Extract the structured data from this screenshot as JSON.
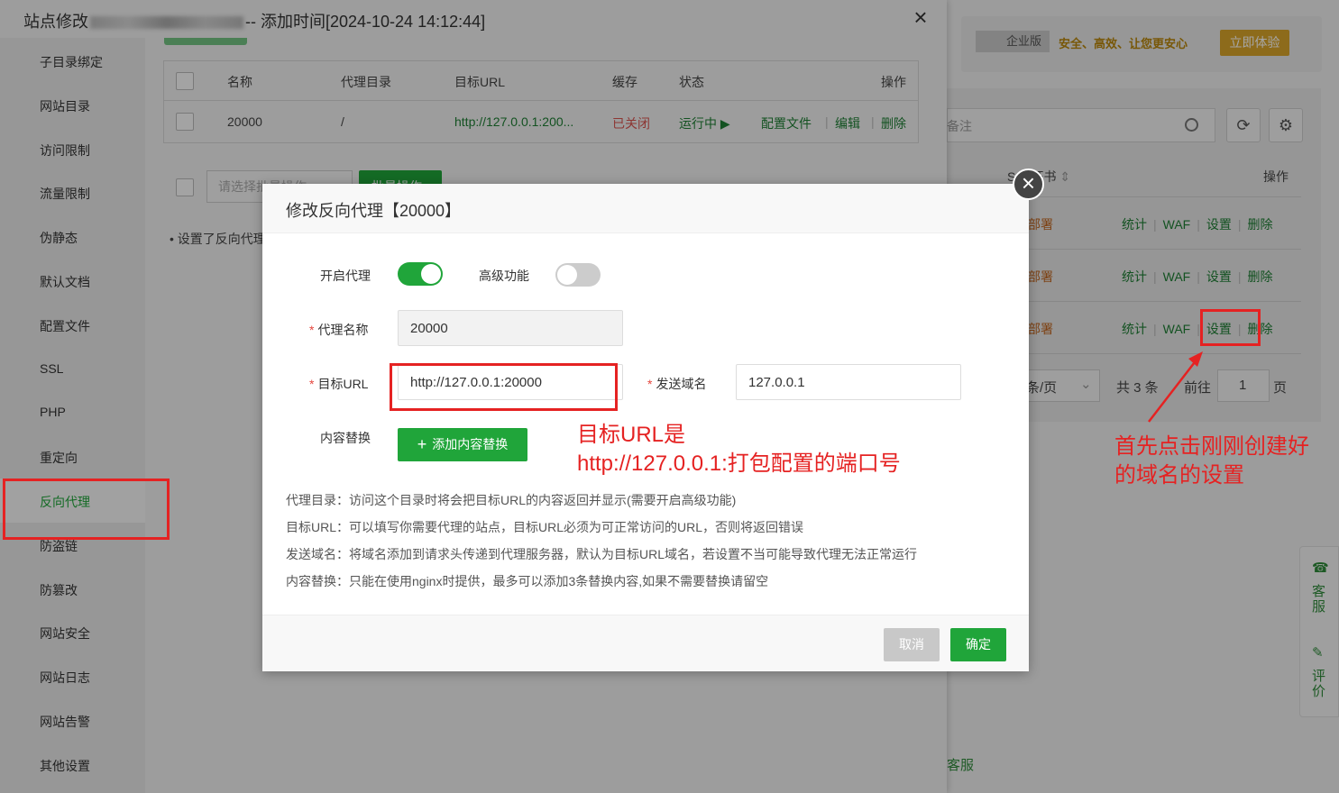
{
  "drawer": {
    "title_prefix": "站点修改",
    "title_suffix": "-- 添加时间[2024-10-24 14:12:44]",
    "close": "×"
  },
  "side_menu": {
    "items": [
      "子目录绑定",
      "网站目录",
      "访问限制",
      "流量限制",
      "伪静态",
      "默认文档",
      "配置文件",
      "SSL",
      "PHP",
      "重定向",
      "反向代理",
      "防盗链",
      "防篡改",
      "网站安全",
      "网站日志",
      "网站告警",
      "其他设置"
    ],
    "active_index": 10
  },
  "proxy_table": {
    "headers": [
      "名称",
      "代理目录",
      "目标URL",
      "缓存",
      "状态",
      "操作"
    ],
    "rows": [
      {
        "name": "20000",
        "dir": "/",
        "url": "http://127.0.0.1:200...",
        "cache": "已关闭",
        "status": "运行中 ▶",
        "ops": [
          "配置文件",
          "编辑",
          "删除"
        ]
      }
    ]
  },
  "batch": {
    "placeholder": "请选择批量操作",
    "button": "批量操作"
  },
  "note": "设置了反向代理",
  "dialog": {
    "title": "修改反向代理【20000】",
    "close": "×",
    "enable_proxy_label": "开启代理",
    "enable_proxy_on": true,
    "advanced_label": "高级功能",
    "advanced_on": false,
    "proxy_name_label": "代理名称",
    "proxy_name_value": "20000",
    "target_url_label": "目标URL",
    "target_url_value": "http://127.0.0.1:20000",
    "send_domain_label": "发送域名",
    "send_domain_value": "127.0.0.1",
    "content_replace_label": "内容替换",
    "add_replace_button": "添加内容替换",
    "help": [
      "代理目录：访问这个目录时将会把目标URL的内容返回并显示(需要开启高级功能)",
      "目标URL：可以填写你需要代理的站点，目标URL必须为可正常访问的URL，否则将返回错误",
      "发送域名：将域名添加到请求头传递到代理服务器，默认为目标URL域名，若设置不当可能导致代理无法正常运行",
      "内容替换：只能在使用nginx时提供，最多可以添加3条替换内容,如果不需要替换请留空"
    ],
    "cancel": "取消",
    "ok": "确定"
  },
  "background": {
    "badge": "企业版",
    "promo_text": "安全、高效、让您更安心",
    "promo_button": "立即体验",
    "search_placeholder": "备注",
    "ssl_header": "SSL证书",
    "ops_header": "操作",
    "rows": [
      {
        "deploy": "部署",
        "ops": [
          "统计",
          "WAF",
          "设置",
          "删除"
        ]
      },
      {
        "deploy": "部署",
        "ops": [
          "统计",
          "WAF",
          "设置",
          "删除"
        ]
      },
      {
        "deploy": "部署",
        "ops": [
          "统计",
          "WAF",
          "设置",
          "删除"
        ]
      }
    ],
    "page_size": "条/页",
    "total": "共 3 条",
    "goto": "前往",
    "page_num": "1",
    "page_unit": "页",
    "side_service": "客服",
    "side_review": "评价",
    "bottom_text": "客服"
  },
  "annotations": {
    "url_note_line1": "目标URL是",
    "url_note_line2": "http://127.0.0.1:打包配置的端口号",
    "settings_note_line1": "首先点击刚刚创建好",
    "settings_note_line2": "的域名的设置",
    "color": "#e52222"
  }
}
